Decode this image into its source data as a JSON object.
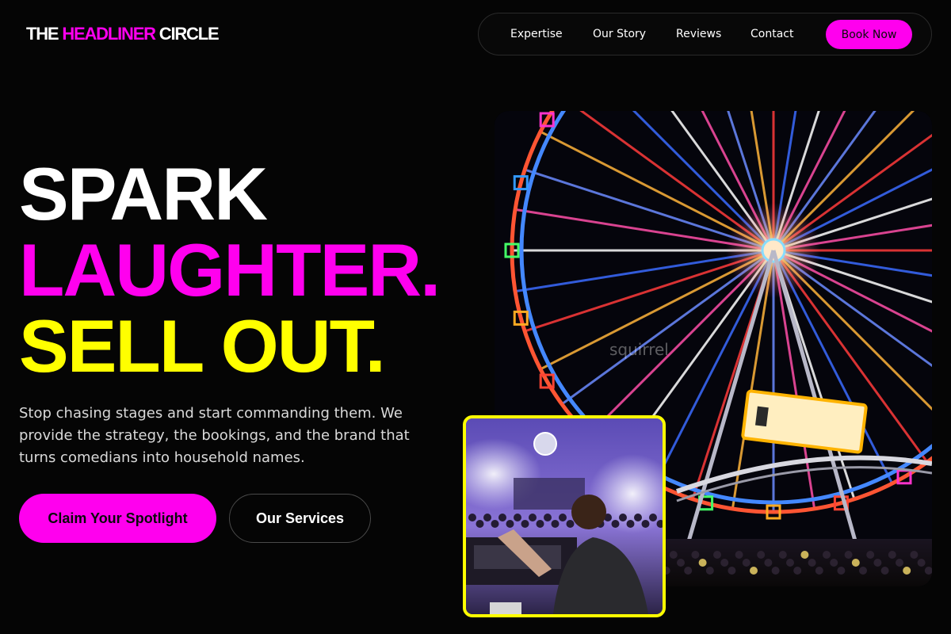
{
  "brand": {
    "logo_part1": "THE ",
    "logo_part2": "HEADLINER",
    "logo_part3": " CIRCLE"
  },
  "nav": {
    "links": [
      "Expertise",
      "Our Story",
      "Reviews",
      "Contact"
    ],
    "cta": "Book Now"
  },
  "hero": {
    "line1": "SPARK",
    "line2": "LAUGHTER.",
    "line3": "SELL OUT.",
    "description": "Stop chasing stages and start commanding them. We provide the strategy, the bookings, and the brand that turns comedians into household names.",
    "primary_cta": "Claim Your Spotlight",
    "secondary_cta": "Our Services"
  },
  "images": {
    "main": "ferris-wheel-photo",
    "inset": "dj-crowd-photo"
  },
  "colors": {
    "background": "#050505",
    "accent_magenta": "#ff00ee",
    "accent_yellow": "#ffff00",
    "text": "#ffffff"
  }
}
